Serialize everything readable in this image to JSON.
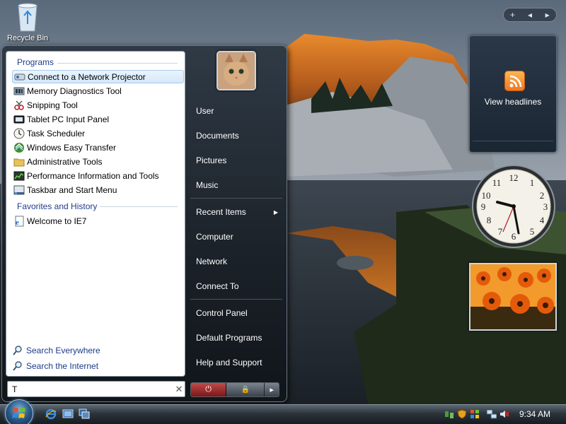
{
  "desktop": {
    "recycle_bin_label": "Recycle Bin",
    "sidebar_controls": [
      "+",
      "◂",
      "▸"
    ],
    "feed_gadget_label": "View headlines"
  },
  "start_menu": {
    "programs_header": "Programs",
    "programs": [
      {
        "label": "Connect to a Network Projector",
        "icon": "projector-icon",
        "selected": true
      },
      {
        "label": "Memory Diagnostics Tool",
        "icon": "memory-diagnostics-icon"
      },
      {
        "label": "Snipping Tool",
        "icon": "snipping-tool-icon"
      },
      {
        "label": "Tablet PC Input Panel",
        "icon": "tablet-input-icon"
      },
      {
        "label": "Task Scheduler",
        "icon": "task-scheduler-icon"
      },
      {
        "label": "Windows Easy Transfer",
        "icon": "easy-transfer-icon"
      },
      {
        "label": "Administrative Tools",
        "icon": "folder-icon"
      },
      {
        "label": "Performance Information and Tools",
        "icon": "performance-icon"
      },
      {
        "label": "Taskbar and Start Menu",
        "icon": "taskbar-settings-icon"
      }
    ],
    "favorites_header": "Favorites and History",
    "favorites": [
      {
        "label": "Welcome to IE7",
        "icon": "ie-page-icon"
      }
    ],
    "search_links": [
      {
        "label": "Search Everywhere",
        "icon": "search-icon"
      },
      {
        "label": "Search the Internet",
        "icon": "search-icon"
      }
    ],
    "search_value": "T",
    "search_clear": "✕",
    "right_pane": {
      "group1": [
        "User",
        "Documents",
        "Pictures",
        "Music"
      ],
      "group2": [
        "Recent Items",
        "Computer",
        "Network",
        "Connect To"
      ],
      "group3": [
        "Control Panel",
        "Default Programs",
        "Help and Support"
      ]
    },
    "power_glyph": "⏻",
    "lock_glyph": "🔒",
    "more_arrow": "▸",
    "submenu_arrow": "▶"
  },
  "taskbar": {
    "time": "9:34 AM",
    "quick_launch": [
      "ie-icon",
      "show-desktop-icon",
      "switch-windows-icon"
    ],
    "tray_icons": [
      "network-tray-icon",
      "security-tray-icon",
      "windows-update-icon",
      "network-status-icon",
      "volume-muted-icon"
    ]
  },
  "colors": {
    "start_menu_bg": "#1b2128",
    "section_header": "#1e3e8c",
    "link_text": "#1b3a8a",
    "selected_bg": "#d5e8f9",
    "power_button": "#a52a2a",
    "rss_orange": "#f0781e"
  }
}
